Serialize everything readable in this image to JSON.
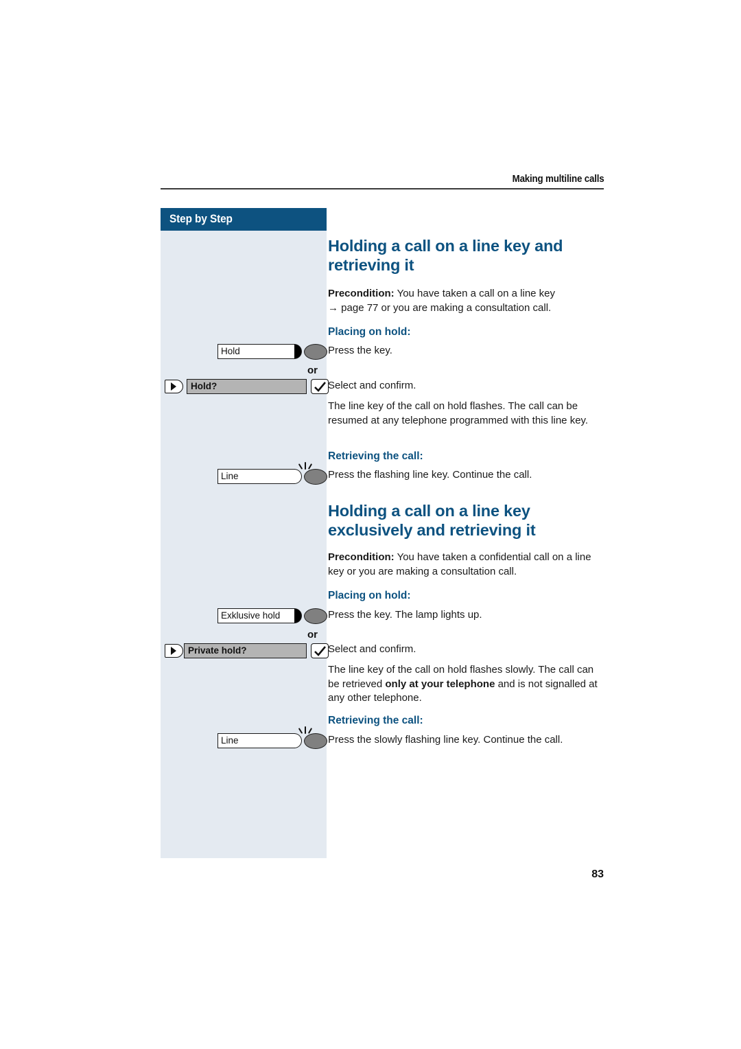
{
  "header": {
    "running_title": "Making multiline calls"
  },
  "sidebar": {
    "banner_label": "Step by Step",
    "background_color": "#e4eaf1",
    "banner_color": "#0d5280",
    "keys": [
      {
        "id": "hold-key",
        "type": "line-key",
        "label": "Hold",
        "lamp": "solid",
        "flashing": false
      },
      {
        "id": "hold-softkey",
        "type": "softkey",
        "label": "Hold?",
        "nav_icon": "nav-right-icon",
        "confirm_icon": "checkmark-icon"
      },
      {
        "id": "line-key-1",
        "type": "line-key",
        "label": "Line",
        "lamp": "hollow",
        "flashing": true
      },
      {
        "id": "exclusive-hold-key",
        "type": "line-key",
        "label": "Exklusive hold",
        "lamp": "solid",
        "flashing": false
      },
      {
        "id": "private-hold-softkey",
        "type": "softkey",
        "label": "Private hold?",
        "nav_icon": "nav-right-icon",
        "confirm_icon": "checkmark-icon"
      },
      {
        "id": "line-key-2",
        "type": "line-key",
        "label": "Line",
        "lamp": "hollow",
        "flashing": true
      }
    ],
    "or_separator_1": "or",
    "or_separator_2": "or"
  },
  "content": {
    "section1": {
      "title": "Holding a call on a line key and retrieving it",
      "precondition_label": "Precondition:",
      "precondition_text": " You have taken a call on a line key",
      "precondition_ref_arrow": "→",
      "precondition_ref_text": " page 77 or you are making a consultation call.",
      "placing_on_hold_heading": "Placing on hold:",
      "press_the_key": "Press the key.",
      "select_and_confirm": "Select and confirm.",
      "hold_explanation": "The line key of the call on hold flashes. The call can be resumed at any telephone programmed with this line key.",
      "retrieving_heading": "Retrieving the call:",
      "retrieving_text": "Press the flashing line key. Continue the call."
    },
    "section2": {
      "title": "Holding a call on a line key exclusively and retrieving it",
      "precondition_label": "Precondition:",
      "precondition_text": " You have taken a confidential call on a line key or you are making a consultation call.",
      "placing_on_hold_heading": "Placing on hold:",
      "press_the_key": "Press the key. The lamp lights up.",
      "select_and_confirm": "Select and confirm.",
      "explanation_part1": "The line key of the call on hold flashes slowly. The call can be retrieved ",
      "explanation_bold": "only at your telephone",
      "explanation_part2": " and is not signalled at any other telephone.",
      "retrieving_heading": "Retrieving the call:",
      "retrieving_text": "Press the slowly flashing line key. Continue the call."
    }
  },
  "footer": {
    "page_number": "83"
  }
}
